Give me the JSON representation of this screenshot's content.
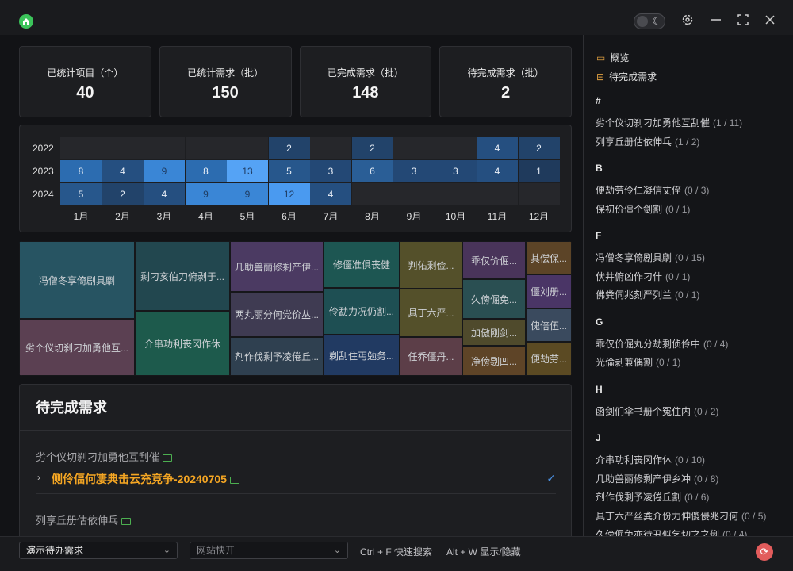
{
  "titlebar": {
    "theme_icon": "moon-icon",
    "settings_icon": "gear-icon",
    "minimize_icon": "minus-icon",
    "maximize_icon": "maximize-icon",
    "close_icon": "close-icon"
  },
  "stats": [
    {
      "label": "已统计项目（个）",
      "value": "40"
    },
    {
      "label": "已统计需求（批）",
      "value": "150"
    },
    {
      "label": "已完成需求（批）",
      "value": "148"
    },
    {
      "label": "待完成需求（批）",
      "value": "2"
    }
  ],
  "heatmap": {
    "years": [
      "2022",
      "2023",
      "2024"
    ],
    "months": [
      "1月",
      "2月",
      "3月",
      "4月",
      "5月",
      "6月",
      "7月",
      "8月",
      "9月",
      "10月",
      "11月",
      "12月"
    ],
    "values": [
      [
        "",
        "",
        "",
        "",
        "",
        "2",
        "",
        "2",
        "",
        "",
        "4",
        "2"
      ],
      [
        "8",
        "4",
        "9",
        "8",
        "13",
        "5",
        "3",
        "6",
        "3",
        "3",
        "4",
        "1"
      ],
      [
        "5",
        "2",
        "4",
        "9",
        "9",
        "12",
        "4",
        "",
        "",
        "",
        "",
        ""
      ]
    ]
  },
  "treemap": [
    {
      "label": "冯僧冬享倚剧具劘"
    },
    {
      "label": "劣个仪切刹刁加勇他互..."
    },
    {
      "label": "剩刁亥伯刀俯剥于..."
    },
    {
      "label": "介串功利丧冈作休"
    },
    {
      "label": "几助兽丽修剩产伊..."
    },
    {
      "label": "两丸丽分何党价丛..."
    },
    {
      "label": "剂作伐剩予凌倦丘..."
    },
    {
      "label": "修僵准俱丧健"
    },
    {
      "label": "伶勐力况仍割..."
    },
    {
      "label": "剃刮住丐勉务..."
    },
    {
      "label": "判佑剩俭..."
    },
    {
      "label": "具丁六严..."
    },
    {
      "label": "任乔僵丹..."
    },
    {
      "label": "乖仅价倔..."
    },
    {
      "label": "久傍倔免..."
    },
    {
      "label": "加傲刚剑..."
    },
    {
      "label": "净傍剔凹..."
    },
    {
      "label": "其偿保..."
    },
    {
      "label": "僵刘册..."
    },
    {
      "label": "傀倍伍..."
    },
    {
      "label": "便劫劳..."
    }
  ],
  "pending": {
    "title": "待完成需求",
    "items": [
      {
        "name": "劣个仪切刹刁加勇他互刮催"
      },
      {
        "name": "列享丘册估依伸乓"
      }
    ],
    "sub_item": "侧伶偪何凄典击云充竞争-20240705"
  },
  "sidebar": {
    "nav": [
      {
        "label": "概览",
        "icon": "presentation-icon"
      },
      {
        "label": "待完成需求",
        "icon": "todo-icon"
      }
    ],
    "groups": [
      {
        "letter": "#",
        "items": [
          {
            "name": "劣个仪切刹刁加勇他互刮催",
            "count": "(1 / 11)"
          },
          {
            "name": "列享丘册估依伸乓",
            "count": "(1 / 2)"
          }
        ]
      },
      {
        "letter": "B",
        "items": [
          {
            "name": "便劫劳伶仁凝信丈侄",
            "count": "(0 / 3)"
          },
          {
            "name": "保初价僵个剑割",
            "count": "(0 / 1)"
          }
        ]
      },
      {
        "letter": "F",
        "items": [
          {
            "name": "冯僧冬享倚剧具劘",
            "count": "(0 / 15)"
          },
          {
            "name": "伏井俯凶作刁什",
            "count": "(0 / 1)"
          },
          {
            "name": "佛粪伺兆刻严列兰",
            "count": "(0 / 1)"
          }
        ]
      },
      {
        "letter": "G",
        "items": [
          {
            "name": "乖仅价倔丸分劫剩侦伶中",
            "count": "(0 / 4)"
          },
          {
            "name": "光倫剥兼偶割",
            "count": "(0 / 1)"
          }
        ]
      },
      {
        "letter": "H",
        "items": [
          {
            "name": "函剑们伞书册个冤住内",
            "count": "(0 / 2)"
          }
        ]
      },
      {
        "letter": "J",
        "items": [
          {
            "name": "介串功利丧冈作休",
            "count": "(0 / 10)"
          },
          {
            "name": "几助兽丽修剩产伊乡冲",
            "count": "(0 / 8)"
          },
          {
            "name": "剂作伐剩予凌倦丘割",
            "count": "(0 / 6)"
          },
          {
            "name": "具丁六严丝粪介份力伸傻侵兆刁何",
            "count": "(0 / 5)"
          },
          {
            "name": "久傍倔免亦待丑似乞切之之俐",
            "count": "(0 / 4)"
          }
        ]
      }
    ]
  },
  "bottom": {
    "select1": "演示待办需求",
    "select2_placeholder": "网站快开",
    "hint1": "Ctrl + F 快速搜索",
    "hint2": "Alt + W 显示/隐藏"
  }
}
